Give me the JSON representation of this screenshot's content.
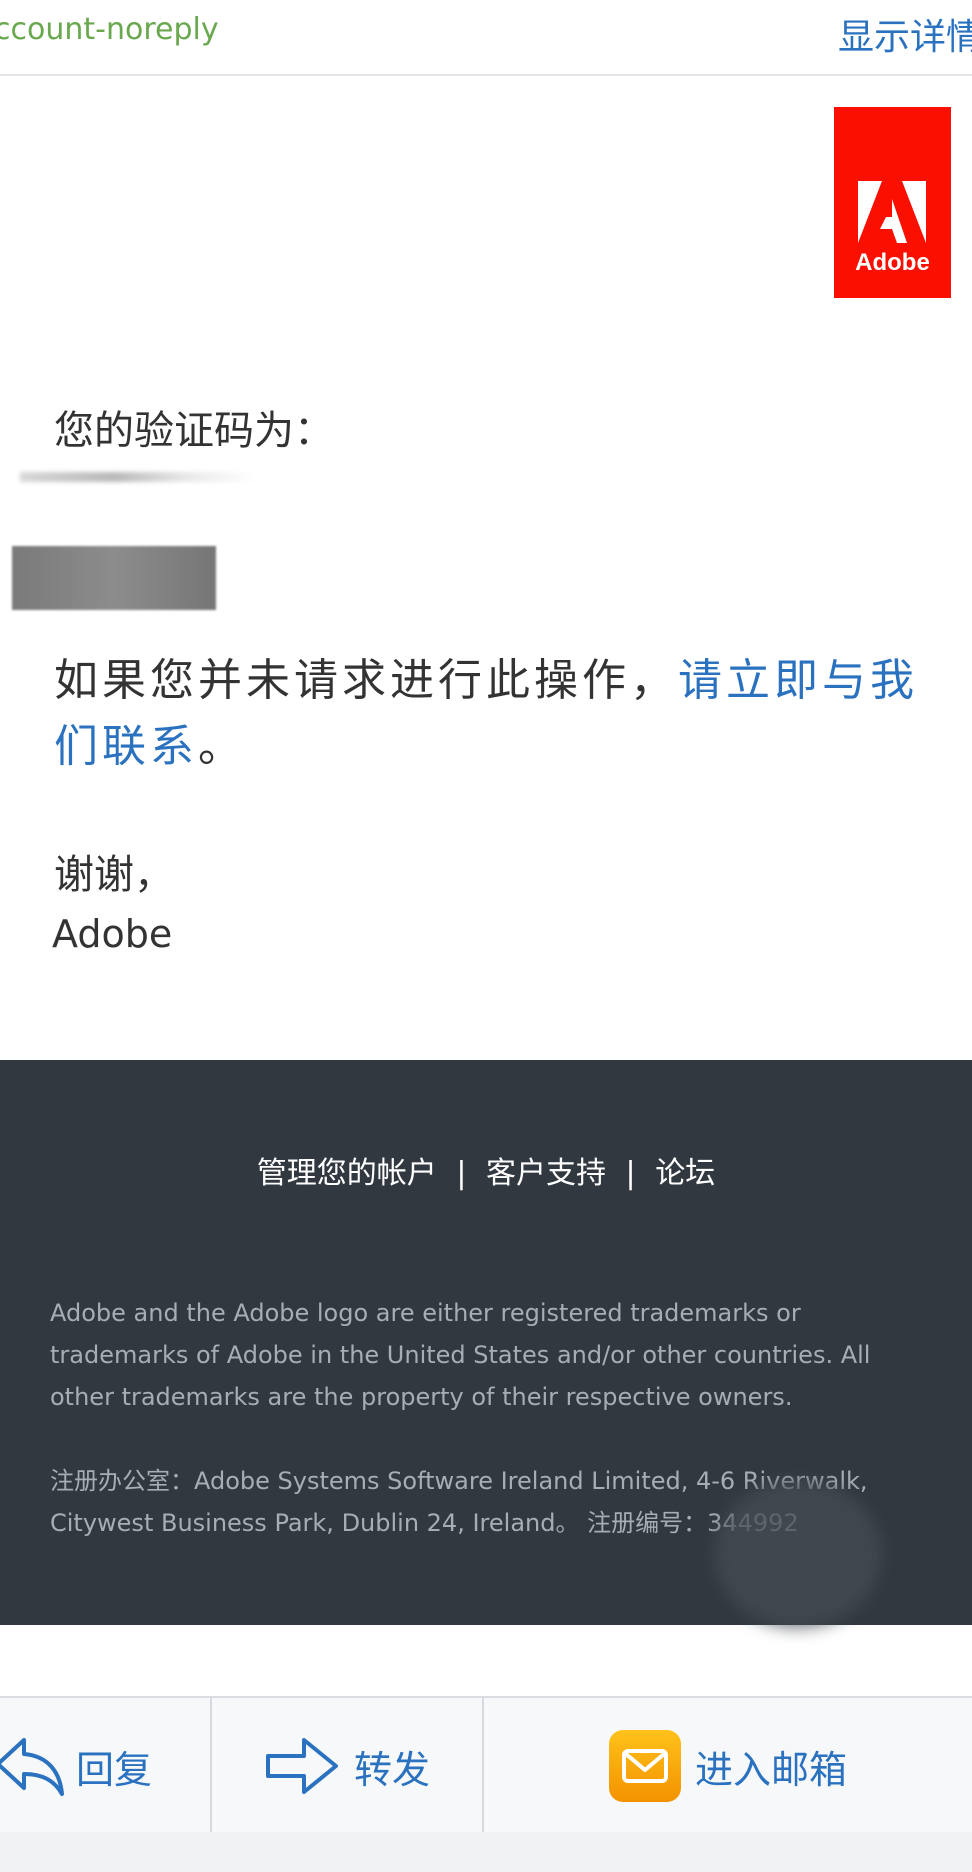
{
  "header": {
    "sender": "ccount-noreply",
    "show_details": "显示详情"
  },
  "logo": {
    "text": "Adobe"
  },
  "message": {
    "code_label": "您的验证码为：",
    "body_prefix": "如果您并未请求进行此操作，",
    "contact_link": "请立即与我们联系",
    "body_suffix": "。",
    "thanks": "谢谢，",
    "signature": "Adobe"
  },
  "footer": {
    "links": [
      "管理您的帐户",
      "客户支持",
      "论坛"
    ],
    "separator": "|",
    "legal": "Adobe and the Adobe logo are either registered trademarks or trademarks of Adobe in the United States and/or other countries. All other trademarks are the property of their respective owners.",
    "office": "注册办公室：Adobe Systems Software Ireland Limited, 4-6 Riverwalk, Citywest Business Park, Dublin 24, Ireland。 注册编号：344992"
  },
  "toolbar": {
    "reply": "回复",
    "forward": "转发",
    "open_mailbox": "进入邮箱"
  },
  "colors": {
    "accent": "#2a72c0",
    "sender": "#6aa84f",
    "brand": "#fa0f00",
    "footer_bg": "#323840"
  }
}
